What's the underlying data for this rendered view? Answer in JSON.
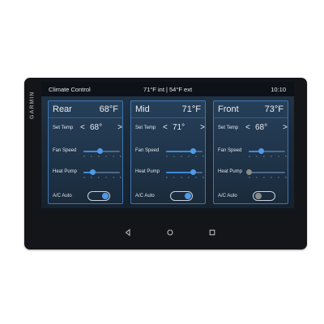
{
  "brand": "GARMIN",
  "status_bar": {
    "title": "Climate Control",
    "temps": "71°F int  |  54°F ext",
    "clock": "10:10"
  },
  "labels": {
    "set_temp": "Set Temp",
    "fan_speed": "Fan Speed",
    "heat_pump": "Heat Pump",
    "ac_auto": "A/C Auto"
  },
  "stepper": {
    "decrease": "<",
    "increase": ">"
  },
  "zones": [
    {
      "name": "Rear",
      "current_temp": "68°F",
      "set_temp": "68°",
      "fan_speed_fraction": 0.45,
      "heat_pump_fraction": 0.25,
      "heat_pump_on": true,
      "ac_auto_on": true
    },
    {
      "name": "Mid",
      "current_temp": "71°F",
      "set_temp": "71°",
      "fan_speed_fraction": 0.75,
      "heat_pump_fraction": 0.75,
      "heat_pump_on": true,
      "ac_auto_on": true
    },
    {
      "name": "Front",
      "current_temp": "73°F",
      "set_temp": "68°",
      "fan_speed_fraction": 0.35,
      "heat_pump_fraction": 0.0,
      "heat_pump_on": false,
      "ac_auto_on": false
    }
  ],
  "slider_ticks": [
    "0",
    "1",
    "2",
    "3",
    "4",
    "5"
  ],
  "tabs": [
    {
      "icon": "home-icon",
      "active": false
    },
    {
      "icon": "thermometer-icon",
      "active": true
    },
    {
      "icon": "lightbulb-icon",
      "active": false
    },
    {
      "icon": "lightning-icon",
      "active": false
    },
    {
      "icon": "rv-vehicle-icon",
      "active": false
    },
    {
      "icon": "fan-icon",
      "active": false
    },
    {
      "icon": "gear-icon",
      "active": false
    }
  ],
  "nav_buttons": [
    {
      "icon": "back-icon"
    },
    {
      "icon": "home-circle-icon"
    },
    {
      "icon": "recents-icon"
    }
  ],
  "colors": {
    "accent": "#3f8ad8",
    "panel_border": "#3f77b3",
    "screen_bg": "#1a2939",
    "bezel": "#141518"
  }
}
